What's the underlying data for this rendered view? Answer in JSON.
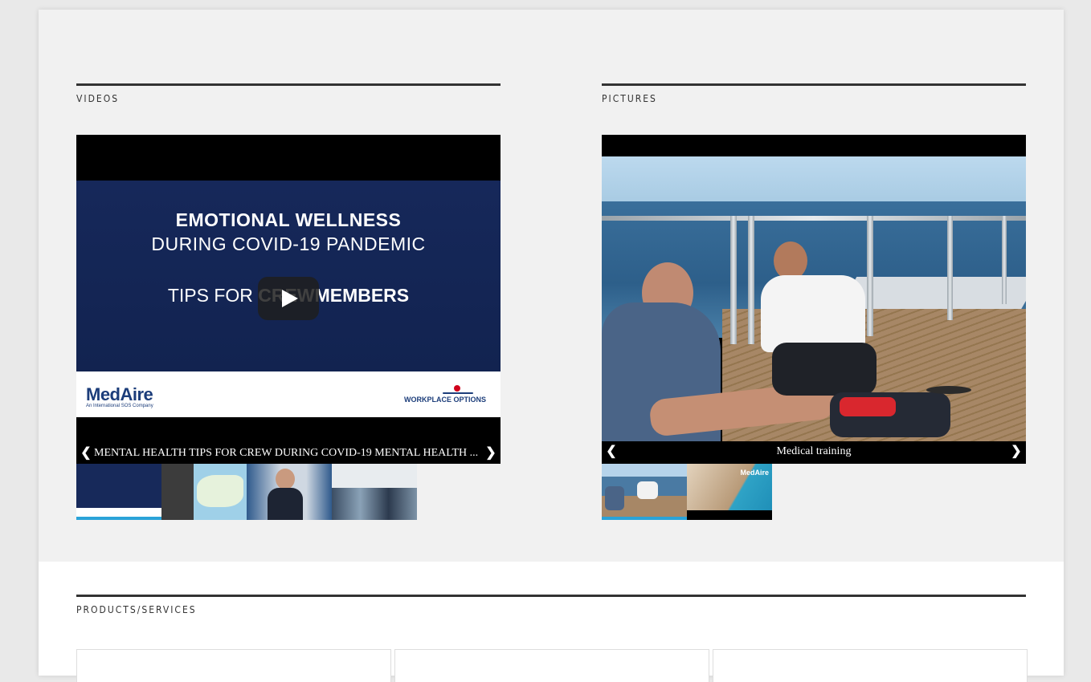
{
  "sections": {
    "videos_title": "VIDEOS",
    "pictures_title": "PICTURES",
    "products_title": "PRODUCTS/SERVICES"
  },
  "video": {
    "slide_line1": "EMOTIONAL WELLNESS",
    "slide_line2": "DURING COVID-19 PANDEMIC",
    "slide_line3_a": "TIPS FOR ",
    "slide_line3_b": "CREWMEMBERS",
    "logo_left": "MedAire",
    "logo_left_sub": "An International SOS Company",
    "logo_right": "WORKPLACE OPTIONS",
    "caption": "MENTAL HEALTH TIPS FOR CREW DURING COVID-19 MENTAL HEALTH ...",
    "prev_glyph": "❮",
    "next_glyph": "❯",
    "thumbnails": [
      "emotional-wellness-thumb",
      "map-app-thumb",
      "news-anchor-thumb",
      "office-thumb"
    ]
  },
  "picture": {
    "caption": "Medical training",
    "prev_glyph": "❮",
    "next_glyph": "❯",
    "thumbnails": [
      "medical-training-thumb",
      "medaire-rock-thumb"
    ],
    "thumb2_logo": "MedAire"
  }
}
